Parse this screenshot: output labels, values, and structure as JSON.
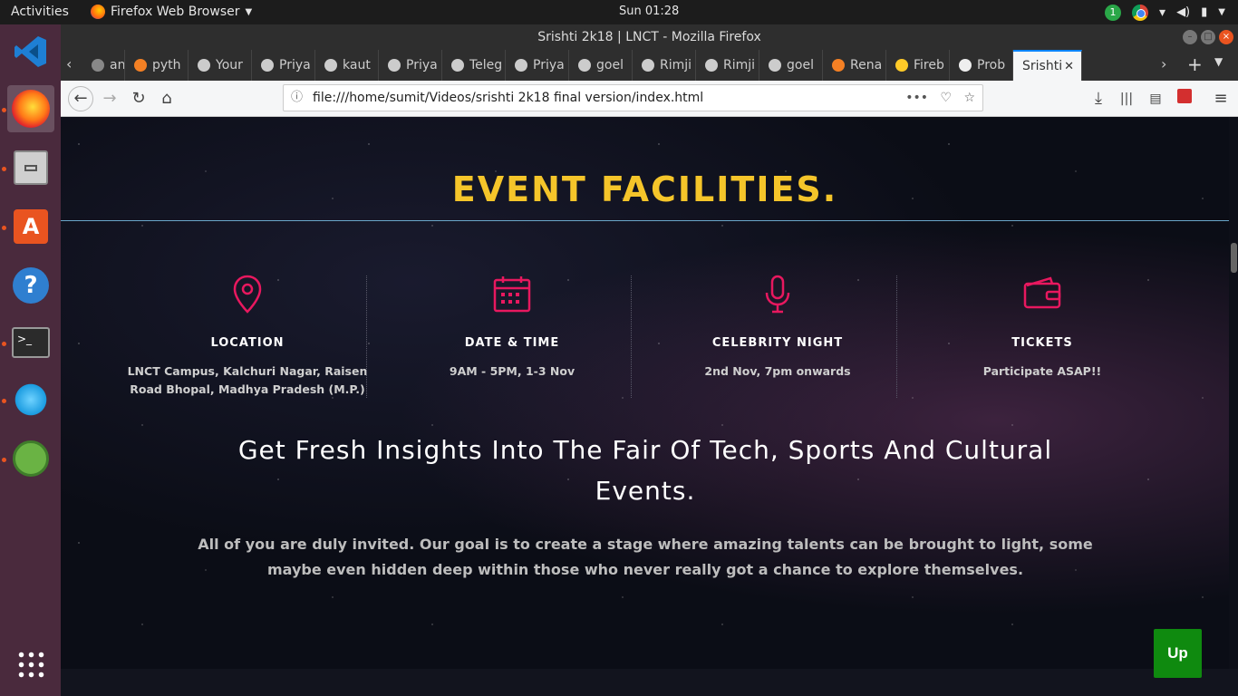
{
  "topbar": {
    "activities": "Activities",
    "app_name": "Firefox Web Browser",
    "clock": "Sun 01:28",
    "update_badge": "1"
  },
  "window": {
    "title": "Srishti 2k18 | LNCT - Mozilla Firefox"
  },
  "tabs": [
    {
      "label": "anje",
      "icon": "page-icon",
      "color": "#888"
    },
    {
      "label": "pyth",
      "icon": "stackoverflow-icon",
      "color": "#f48024"
    },
    {
      "label": "Your",
      "icon": "github-icon",
      "color": "#ccc"
    },
    {
      "label": "Priya",
      "icon": "github-icon",
      "color": "#ccc"
    },
    {
      "label": "kaut",
      "icon": "github-icon",
      "color": "#ccc"
    },
    {
      "label": "Priya",
      "icon": "github-icon",
      "color": "#ccc"
    },
    {
      "label": "Teleg",
      "icon": "github-icon",
      "color": "#ccc"
    },
    {
      "label": "Priya",
      "icon": "github-icon",
      "color": "#ccc"
    },
    {
      "label": "goel",
      "icon": "github-icon",
      "color": "#ccc"
    },
    {
      "label": "Rimji",
      "icon": "github-icon",
      "color": "#ccc"
    },
    {
      "label": "Rimji",
      "icon": "github-icon",
      "color": "#ccc"
    },
    {
      "label": "goel",
      "icon": "github-icon",
      "color": "#ccc"
    },
    {
      "label": "Rena",
      "icon": "stackoverflow-icon",
      "color": "#f48024"
    },
    {
      "label": "Fireb",
      "icon": "firebase-icon",
      "color": "#ffca28"
    },
    {
      "label": "Prob",
      "icon": "warning-icon",
      "color": "#eee"
    },
    {
      "label": "Srishti",
      "icon": "none",
      "color": "#333",
      "active": true
    }
  ],
  "navbar": {
    "url": "file:///home/sumit/Videos/srishti 2k18 final version/index.html"
  },
  "page": {
    "title": "EVENT FACILITIES.",
    "accent": "#f5c52a",
    "icon_color": "#e8185f",
    "facilities": [
      {
        "icon": "map-pin-icon",
        "heading": "LOCATION",
        "detail": "LNCT Campus, Kalchuri Nagar, Raisen Road Bhopal, Madhya Pradesh (M.P.)"
      },
      {
        "icon": "calendar-icon",
        "heading": "DATE & TIME",
        "detail": "9AM - 5PM, 1-3 Nov"
      },
      {
        "icon": "microphone-icon",
        "heading": "CELEBRITY NIGHT",
        "detail": "2nd Nov, 7pm onwards"
      },
      {
        "icon": "wallet-icon",
        "heading": "TICKETS",
        "detail": "Participate ASAP!!"
      }
    ],
    "headline": "Get Fresh Insights Into The Fair Of Tech, Sports And Cultural Events.",
    "paragraph": "All of you are duly invited. Our goal is to create a stage where amazing talents can be brought to light, some maybe even hidden deep within those who never really got a chance to explore themselves.",
    "up_button": "Up"
  }
}
